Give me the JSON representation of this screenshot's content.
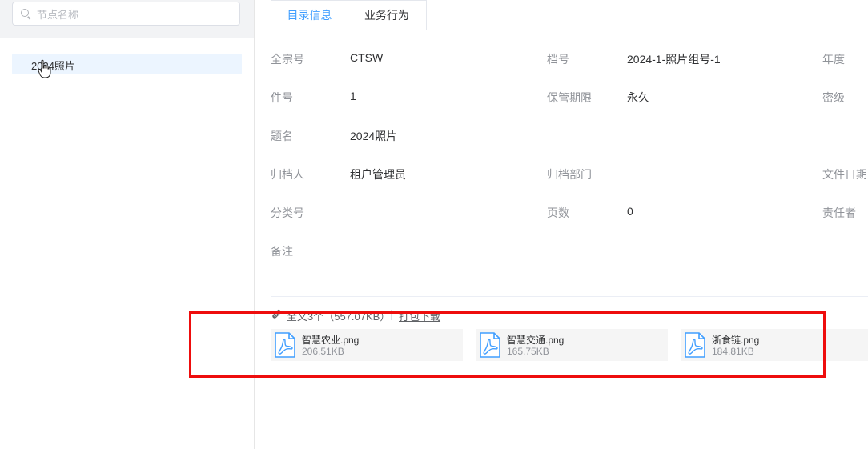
{
  "search": {
    "placeholder": "节点名称"
  },
  "tree": {
    "selected_node": "2024照片"
  },
  "tabs": [
    {
      "label": "目录信息",
      "active": true
    },
    {
      "label": "业务行为",
      "active": false
    }
  ],
  "info": {
    "rows": [
      [
        {
          "label": "全宗号",
          "value": "CTSW"
        },
        {
          "label": "档号",
          "value": "2024-1-照片组号-1"
        },
        {
          "label": "年度",
          "value": ""
        }
      ],
      [
        {
          "label": "件号",
          "value": "1"
        },
        {
          "label": "保管期限",
          "value": "永久"
        },
        {
          "label": "密级",
          "value": ""
        }
      ],
      [
        {
          "label": "题名",
          "value": "2024照片"
        }
      ],
      [
        {
          "label": "归档人",
          "value": "租户管理员"
        },
        {
          "label": "归档部门",
          "value": ""
        },
        {
          "label": "文件日期",
          "value": ""
        }
      ],
      [
        {
          "label": "分类号",
          "value": ""
        },
        {
          "label": "页数",
          "value": "0"
        },
        {
          "label": "责任者",
          "value": ""
        }
      ],
      [
        {
          "label": "备注",
          "value": ""
        }
      ]
    ]
  },
  "attachments": {
    "title": "全文3个（557.07KB）",
    "download_label": "打包下载",
    "files": [
      {
        "name": "智慧农业.png",
        "size": "206.51KB",
        "icon": "pdf-file-icon"
      },
      {
        "name": "智慧交通.png",
        "size": "165.75KB",
        "icon": "pdf-file-icon"
      },
      {
        "name": "浙食链.png",
        "size": "184.81KB",
        "icon": "pdf-file-icon"
      }
    ]
  },
  "colors": {
    "accent": "#409eff",
    "highlight": "#ee0d0d",
    "label": "#909399",
    "selected_bg": "#ecf5ff"
  }
}
